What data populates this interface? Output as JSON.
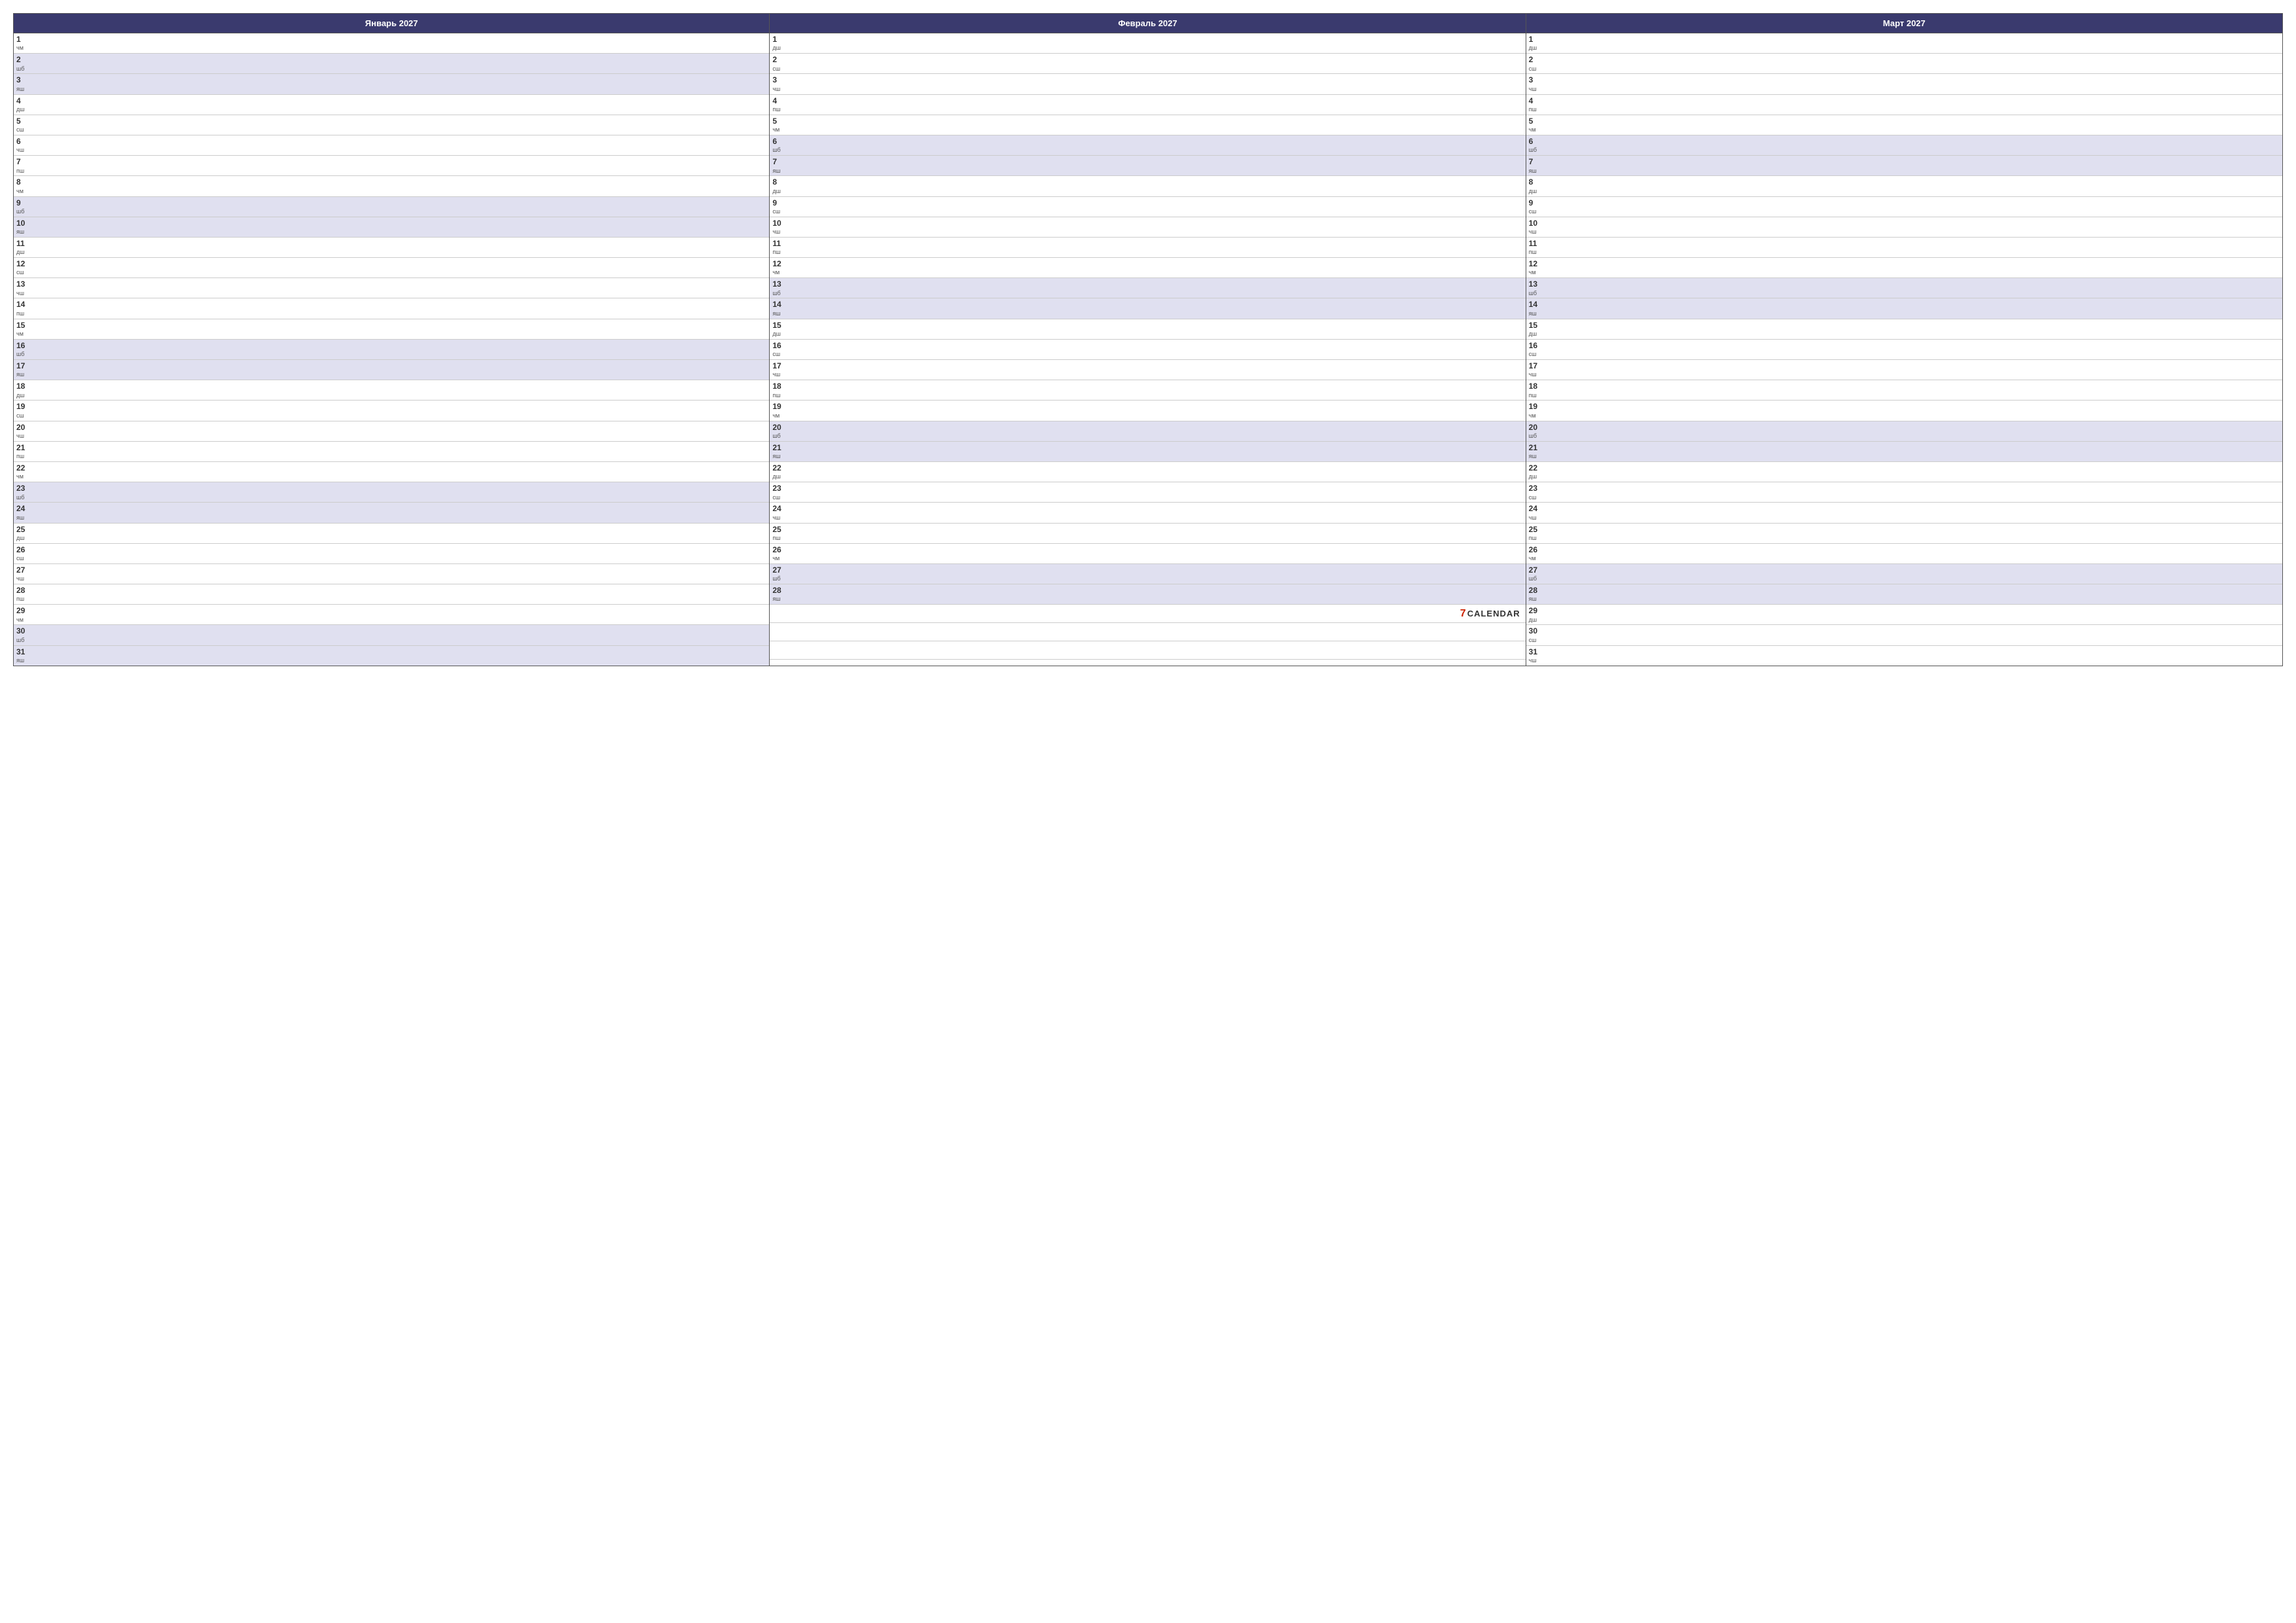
{
  "months": [
    {
      "name": "Январь 2027",
      "days": [
        {
          "num": 1,
          "name": "чм",
          "weekend": false
        },
        {
          "num": 2,
          "name": "шб",
          "weekend": true
        },
        {
          "num": 3,
          "name": "яш",
          "weekend": true
        },
        {
          "num": 4,
          "name": "дш",
          "weekend": false
        },
        {
          "num": 5,
          "name": "сш",
          "weekend": false
        },
        {
          "num": 6,
          "name": "чш",
          "weekend": false
        },
        {
          "num": 7,
          "name": "пш",
          "weekend": false
        },
        {
          "num": 8,
          "name": "чм",
          "weekend": false
        },
        {
          "num": 9,
          "name": "шб",
          "weekend": true
        },
        {
          "num": 10,
          "name": "яш",
          "weekend": true
        },
        {
          "num": 11,
          "name": "дш",
          "weekend": false
        },
        {
          "num": 12,
          "name": "сш",
          "weekend": false
        },
        {
          "num": 13,
          "name": "чш",
          "weekend": false
        },
        {
          "num": 14,
          "name": "пш",
          "weekend": false
        },
        {
          "num": 15,
          "name": "чм",
          "weekend": false
        },
        {
          "num": 16,
          "name": "шб",
          "weekend": true
        },
        {
          "num": 17,
          "name": "яш",
          "weekend": true
        },
        {
          "num": 18,
          "name": "дш",
          "weekend": false
        },
        {
          "num": 19,
          "name": "сш",
          "weekend": false
        },
        {
          "num": 20,
          "name": "чш",
          "weekend": false
        },
        {
          "num": 21,
          "name": "пш",
          "weekend": false
        },
        {
          "num": 22,
          "name": "чм",
          "weekend": false
        },
        {
          "num": 23,
          "name": "шб",
          "weekend": true
        },
        {
          "num": 24,
          "name": "яш",
          "weekend": true
        },
        {
          "num": 25,
          "name": "дш",
          "weekend": false
        },
        {
          "num": 26,
          "name": "сш",
          "weekend": false
        },
        {
          "num": 27,
          "name": "чш",
          "weekend": false
        },
        {
          "num": 28,
          "name": "пш",
          "weekend": false
        },
        {
          "num": 29,
          "name": "чм",
          "weekend": false
        },
        {
          "num": 30,
          "name": "шб",
          "weekend": true
        },
        {
          "num": 31,
          "name": "яш",
          "weekend": true
        }
      ]
    },
    {
      "name": "Февраль 2027",
      "days": [
        {
          "num": 1,
          "name": "дш",
          "weekend": false
        },
        {
          "num": 2,
          "name": "сш",
          "weekend": false
        },
        {
          "num": 3,
          "name": "чш",
          "weekend": false
        },
        {
          "num": 4,
          "name": "пш",
          "weekend": false
        },
        {
          "num": 5,
          "name": "чм",
          "weekend": false
        },
        {
          "num": 6,
          "name": "шб",
          "weekend": true
        },
        {
          "num": 7,
          "name": "яш",
          "weekend": true
        },
        {
          "num": 8,
          "name": "дш",
          "weekend": false
        },
        {
          "num": 9,
          "name": "сш",
          "weekend": false
        },
        {
          "num": 10,
          "name": "чш",
          "weekend": false
        },
        {
          "num": 11,
          "name": "пш",
          "weekend": false
        },
        {
          "num": 12,
          "name": "чм",
          "weekend": false
        },
        {
          "num": 13,
          "name": "шб",
          "weekend": true
        },
        {
          "num": 14,
          "name": "яш",
          "weekend": true
        },
        {
          "num": 15,
          "name": "дш",
          "weekend": false
        },
        {
          "num": 16,
          "name": "сш",
          "weekend": false
        },
        {
          "num": 17,
          "name": "чш",
          "weekend": false
        },
        {
          "num": 18,
          "name": "пш",
          "weekend": false
        },
        {
          "num": 19,
          "name": "чм",
          "weekend": false
        },
        {
          "num": 20,
          "name": "шб",
          "weekend": true
        },
        {
          "num": 21,
          "name": "яш",
          "weekend": true
        },
        {
          "num": 22,
          "name": "дш",
          "weekend": false
        },
        {
          "num": 23,
          "name": "сш",
          "weekend": false
        },
        {
          "num": 24,
          "name": "чш",
          "weekend": false
        },
        {
          "num": 25,
          "name": "пш",
          "weekend": false
        },
        {
          "num": 26,
          "name": "чм",
          "weekend": false
        },
        {
          "num": 27,
          "name": "шб",
          "weekend": true
        },
        {
          "num": 28,
          "name": "яш",
          "weekend": true
        }
      ]
    },
    {
      "name": "Март 2027",
      "days": [
        {
          "num": 1,
          "name": "дш",
          "weekend": false
        },
        {
          "num": 2,
          "name": "сш",
          "weekend": false
        },
        {
          "num": 3,
          "name": "чш",
          "weekend": false
        },
        {
          "num": 4,
          "name": "пш",
          "weekend": false
        },
        {
          "num": 5,
          "name": "чм",
          "weekend": false
        },
        {
          "num": 6,
          "name": "шб",
          "weekend": true
        },
        {
          "num": 7,
          "name": "яш",
          "weekend": true
        },
        {
          "num": 8,
          "name": "дш",
          "weekend": false
        },
        {
          "num": 9,
          "name": "сш",
          "weekend": false
        },
        {
          "num": 10,
          "name": "чш",
          "weekend": false
        },
        {
          "num": 11,
          "name": "пш",
          "weekend": false
        },
        {
          "num": 12,
          "name": "чм",
          "weekend": false
        },
        {
          "num": 13,
          "name": "шб",
          "weekend": true
        },
        {
          "num": 14,
          "name": "яш",
          "weekend": true
        },
        {
          "num": 15,
          "name": "дш",
          "weekend": false
        },
        {
          "num": 16,
          "name": "сш",
          "weekend": false
        },
        {
          "num": 17,
          "name": "чш",
          "weekend": false
        },
        {
          "num": 18,
          "name": "пш",
          "weekend": false
        },
        {
          "num": 19,
          "name": "чм",
          "weekend": false
        },
        {
          "num": 20,
          "name": "шб",
          "weekend": true
        },
        {
          "num": 21,
          "name": "яш",
          "weekend": true
        },
        {
          "num": 22,
          "name": "дш",
          "weekend": false
        },
        {
          "num": 23,
          "name": "сш",
          "weekend": false
        },
        {
          "num": 24,
          "name": "чш",
          "weekend": false
        },
        {
          "num": 25,
          "name": "пш",
          "weekend": false
        },
        {
          "num": 26,
          "name": "чм",
          "weekend": false
        },
        {
          "num": 27,
          "name": "шб",
          "weekend": true
        },
        {
          "num": 28,
          "name": "яш",
          "weekend": true
        },
        {
          "num": 29,
          "name": "дш",
          "weekend": false
        },
        {
          "num": 30,
          "name": "сш",
          "weekend": false
        },
        {
          "num": 31,
          "name": "чш",
          "weekend": false
        }
      ]
    }
  ],
  "logo": {
    "number": "7",
    "text": "CALENDAR"
  }
}
